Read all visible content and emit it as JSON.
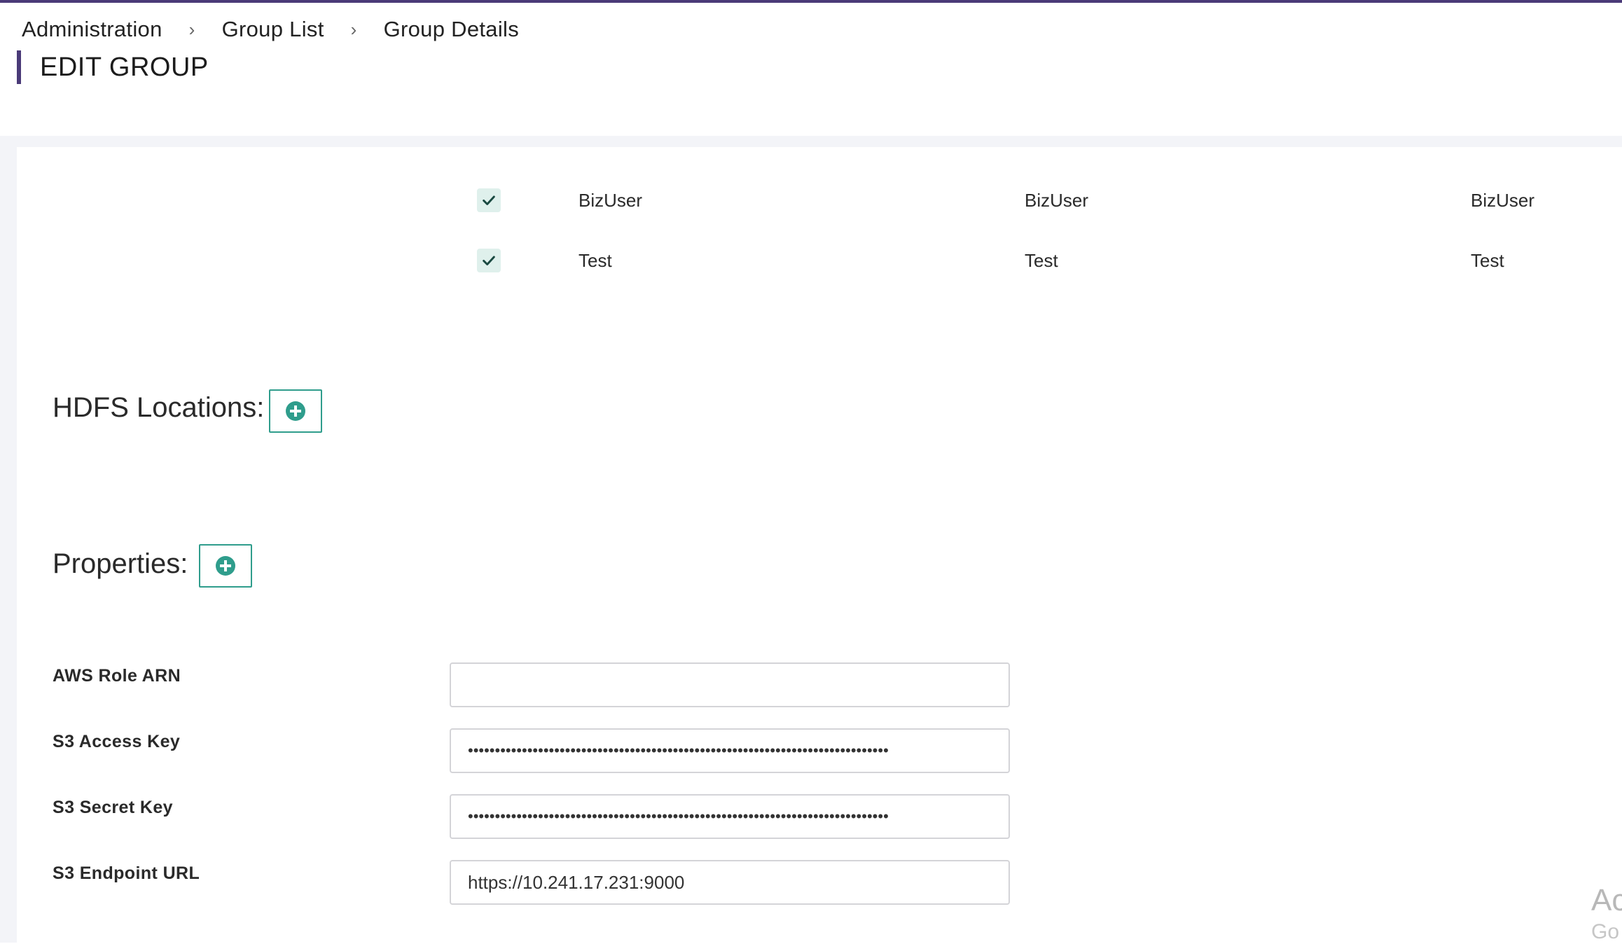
{
  "breadcrumb": {
    "items": [
      "Administration",
      "Group List",
      "Group Details"
    ],
    "separator": "›"
  },
  "page": {
    "title": "EDIT GROUP"
  },
  "users": [
    {
      "checked": true,
      "col1": "BizUser",
      "col2": "BizUser",
      "col3": "BizUser"
    },
    {
      "checked": true,
      "col1": "Test",
      "col2": "Test",
      "col3": "Test"
    }
  ],
  "hdfs": {
    "label": "HDFS Locations:",
    "add_icon": "plus-circle-icon"
  },
  "properties": {
    "label": "Properties:",
    "add_icon": "plus-circle-icon",
    "fields": [
      {
        "label": "AWS Role ARN",
        "value": "",
        "type": "text"
      },
      {
        "label": "S3 Access Key",
        "value": "••••••••••••••••••••••••••••••••••••••••••••••••••••••••••••••••••••••••••••••",
        "type": "password"
      },
      {
        "label": "S3 Secret Key",
        "value": "••••••••••••••••••••••••••••••••••••••••••••••••••••••••••••••••••••••••••••••",
        "type": "password"
      },
      {
        "label": "S3 Endpoint URL",
        "value": "https://10.241.17.231:9000",
        "type": "text"
      }
    ]
  },
  "watermark": {
    "line1": "Ac",
    "line2": "Go"
  },
  "colors": {
    "accent": "#4a3a78",
    "teal": "#2f9d8c",
    "checkbox_bg": "#dff0ec"
  }
}
